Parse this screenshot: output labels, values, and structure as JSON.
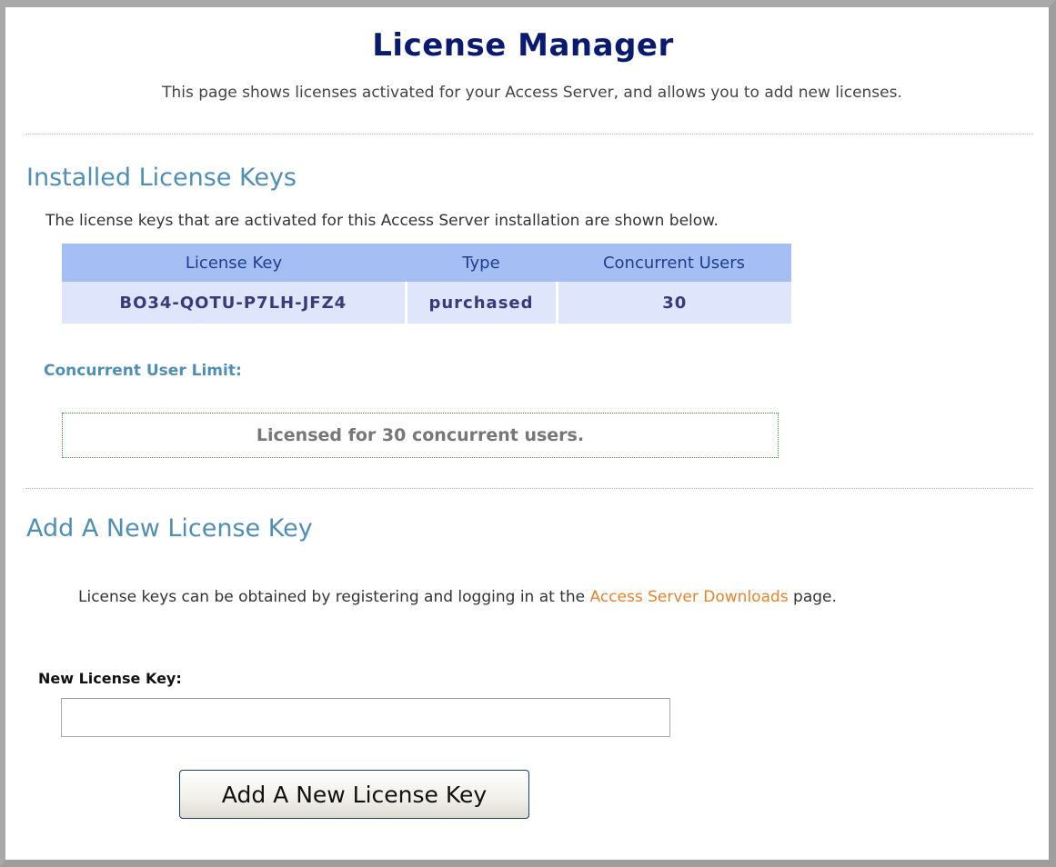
{
  "header": {
    "title": "License Manager",
    "subtitle": "This page shows licenses activated for your Access Server, and allows you to add new licenses."
  },
  "installed": {
    "title": "Installed License Keys",
    "description": "The license keys that are activated for this Access Server installation are shown below.",
    "columns": [
      "License Key",
      "Type",
      "Concurrent Users"
    ],
    "rows": [
      {
        "key": "BO34-QOTU-P7LH-JFZ4",
        "type": "purchased",
        "users": "30"
      }
    ],
    "limit_label": "Concurrent User Limit:",
    "limit_text": "Licensed for 30 concurrent users."
  },
  "add_key": {
    "title": "Add A New License Key",
    "description_before": "License keys can be obtained by registering and logging in at the ",
    "link_text": "Access Server Downloads",
    "description_after": " page.",
    "field_label": "New License Key:",
    "input_value": "",
    "input_placeholder": "",
    "button_label": "Add A New License Key"
  },
  "colors": {
    "title": "#0a1a6e",
    "section_heading": "#4f8fb6",
    "table_header_bg": "#a5bff4",
    "table_row_bg": "#dfe6fb",
    "link": "#e8832a",
    "limit_box_border": "#2e8b2e"
  }
}
